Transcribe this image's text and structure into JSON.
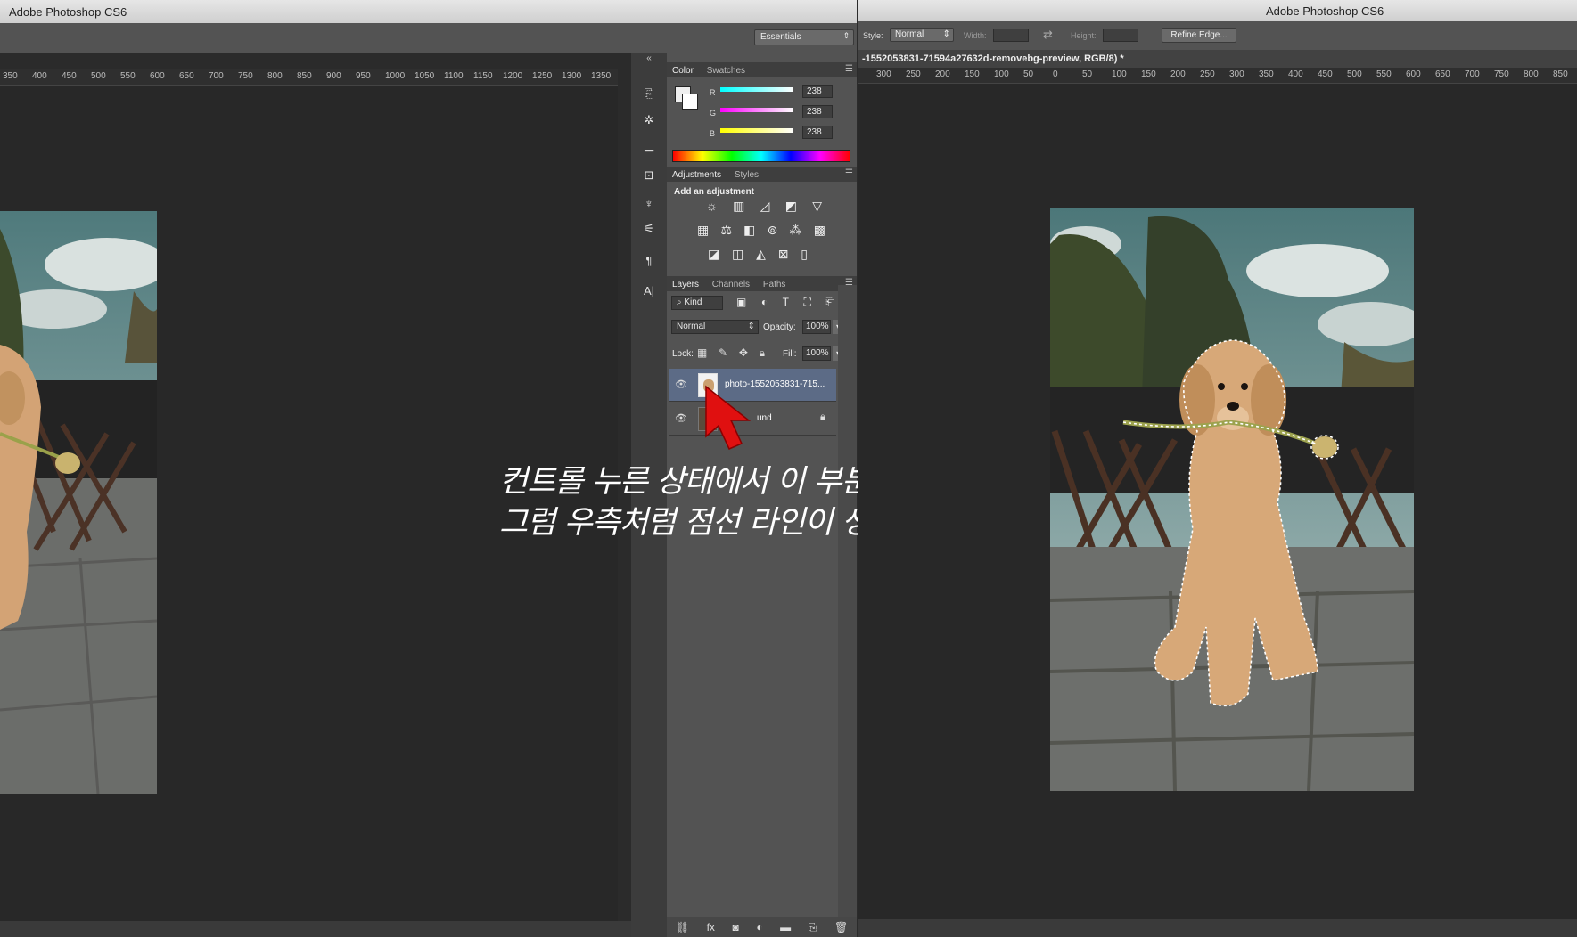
{
  "left_window": {
    "title": "Adobe Photoshop CS6",
    "workspace": "Essentials",
    "ruler_ticks": [
      "350",
      "400",
      "450",
      "500",
      "550",
      "600",
      "650",
      "700",
      "750",
      "800",
      "850",
      "900",
      "950",
      "1000",
      "1050",
      "1100",
      "1150",
      "1200",
      "1250",
      "1300",
      "1350"
    ]
  },
  "right_window": {
    "title": "Adobe Photoshop CS6",
    "style_label": "Style:",
    "style_value": "Normal",
    "width_label": "Width:",
    "height_label": "Height:",
    "refine_edge": "Refine Edge...",
    "doc_tab": "-1552053831-71594a27632d-removebg-preview, RGB/8) *",
    "ruler_ticks": [
      "300",
      "250",
      "200",
      "150",
      "100",
      "50",
      "0",
      "50",
      "100",
      "150",
      "200",
      "250",
      "300",
      "350",
      "400",
      "450",
      "500",
      "550",
      "600",
      "650",
      "700",
      "750",
      "800",
      "850"
    ]
  },
  "color_panel": {
    "tabs": [
      "Color",
      "Swatches"
    ],
    "r_label": "R",
    "g_label": "G",
    "b_label": "B",
    "r": "238",
    "g": "238",
    "b": "238"
  },
  "adjustments_panel": {
    "tabs": [
      "Adjustments",
      "Styles"
    ],
    "heading": "Add an adjustment"
  },
  "layers_panel": {
    "tabs": [
      "Layers",
      "Channels",
      "Paths"
    ],
    "kind": "Kind",
    "blend_mode": "Normal",
    "opacity_label": "Opacity:",
    "opacity": "100%",
    "lock_label": "Lock:",
    "fill_label": "Fill:",
    "fill": "100%",
    "layers": [
      {
        "name": "photo-1552053831-715..."
      },
      {
        "name": "und"
      }
    ]
  },
  "annotation": {
    "line1": "컨트롤 누른 상태에서 이 부분을 클릭!",
    "line2": "그럼 우측처럼 점선 라인이 생김"
  },
  "colors": {
    "accent_cursor": "#e01010",
    "selected_layer": "#5c6b86"
  }
}
